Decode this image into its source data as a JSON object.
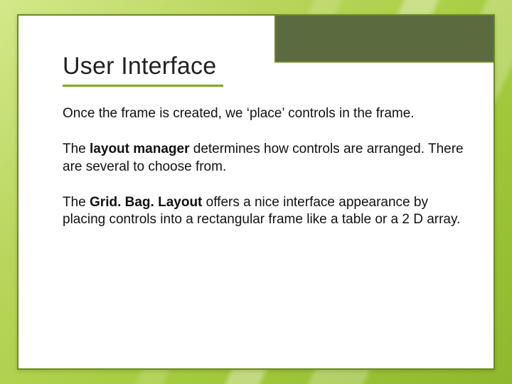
{
  "slide": {
    "title": "User Interface",
    "p1": "Once the frame is created, we ‘place’ controls in the frame.",
    "p2_pre": "The ",
    "p2_bold": "layout manager",
    "p2_post": " determines how controls are arranged.  There are several to choose from.",
    "p3_pre": "The ",
    "p3_bold": "Grid. Bag. Layout",
    "p3_post": " offers a nice interface appearance by placing controls into a rectangular frame like a table or a 2 D array."
  }
}
